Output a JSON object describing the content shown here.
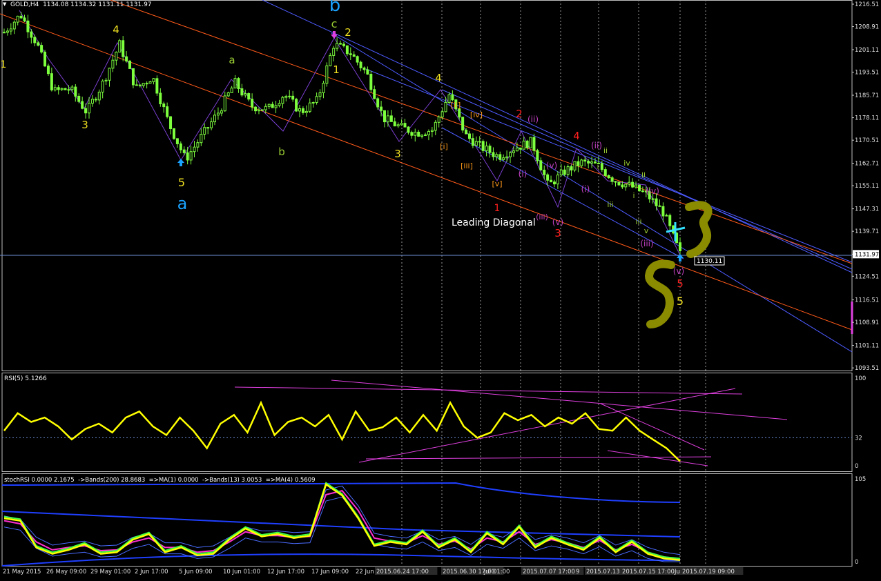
{
  "window": {
    "symbol_header": "GOLD,H4  1134.08 1134.32 1131.11 1131.97",
    "collapse_glyph": "▼",
    "current_price_tag": "1131.97",
    "marker_price_tag": "1130.11",
    "leading_diagonal_text": "Leading Diagonal"
  },
  "colors": {
    "background": "#000000",
    "candles": "#7dff3e",
    "rsi_line": "#ffff00",
    "trend_magenta": "#e040e0",
    "channel_blue": "#4d5bff",
    "channel_orange": "#ff5a1a",
    "wave_yellow": "#f0e020",
    "wave_olive_green": "#9acd32",
    "wave_red": "#ff2020",
    "wave_cyan": "#1aa3ff",
    "wave_orange": "#ff9a1a",
    "wave_violet": "#c040c0",
    "olive_marker": "#8b8b00"
  },
  "chart_data": [
    {
      "type": "candlestick",
      "title": "GOLD,H4",
      "ylim": [
        1093.55,
        1216.51
      ],
      "y_ticks": [
        "1216.51",
        "1208.91",
        "1201.11",
        "1193.51",
        "1185.71",
        "1178.11",
        "1170.51",
        "1162.71",
        "1155.11",
        "1147.31",
        "1139.71",
        "1131.97",
        "1124.51",
        "1116.51",
        "1108.91",
        "1101.11",
        "1093.51"
      ],
      "close_path_approx": [
        {
          "x": "21 May 2015",
          "close": 1207
        },
        {
          "x": "22 May 2015",
          "close": 1213
        },
        {
          "x": "25 May 2015",
          "close": 1203
        },
        {
          "x": "26 May 2015",
          "close": 1187
        },
        {
          "x": "27 May 2015",
          "close": 1188
        },
        {
          "x": "28 May 2015",
          "close": 1180
        },
        {
          "x": "29 May 2015",
          "close": 1190
        },
        {
          "x": "01 Jun 2015",
          "close": 1203
        },
        {
          "x": "02 Jun 2015",
          "close": 1188
        },
        {
          "x": "03 Jun 2015",
          "close": 1192
        },
        {
          "x": "04 Jun 2015",
          "close": 1176
        },
        {
          "x": "05 Jun 2015",
          "close": 1164
        },
        {
          "x": "08 Jun 2015",
          "close": 1172
        },
        {
          "x": "09 Jun 2015",
          "close": 1180
        },
        {
          "x": "10 Jun 2015",
          "close": 1190
        },
        {
          "x": "11 Jun 2015",
          "close": 1182
        },
        {
          "x": "12 Jun 2015",
          "close": 1181
        },
        {
          "x": "15 Jun 2015",
          "close": 1186
        },
        {
          "x": "16 Jun 2015",
          "close": 1180
        },
        {
          "x": "17 Jun 2015",
          "close": 1184
        },
        {
          "x": "18 Jun 2015",
          "close": 1203
        },
        {
          "x": "19 Jun 2015",
          "close": 1200
        },
        {
          "x": "22 Jun 2015",
          "close": 1193
        },
        {
          "x": "23 Jun 2015",
          "close": 1178
        },
        {
          "x": "24 Jun 2015",
          "close": 1175
        },
        {
          "x": "25 Jun 2015",
          "close": 1173
        },
        {
          "x": "26 Jun 2015",
          "close": 1174
        },
        {
          "x": "29 Jun 2015",
          "close": 1186
        },
        {
          "x": "30 Jun 2015",
          "close": 1172
        },
        {
          "x": "01 Jul 2015",
          "close": 1168
        },
        {
          "x": "02 Jul 2015",
          "close": 1165
        },
        {
          "x": "03 Jul 2015",
          "close": 1168
        },
        {
          "x": "06 Jul 2015",
          "close": 1170
        },
        {
          "x": "07 Jul 2015",
          "close": 1155
        },
        {
          "x": "08 Jul 2015",
          "close": 1160
        },
        {
          "x": "09 Jul 2015",
          "close": 1163
        },
        {
          "x": "10 Jul 2015",
          "close": 1162
        },
        {
          "x": "13 Jul 2015",
          "close": 1157
        },
        {
          "x": "14 Jul 2015",
          "close": 1155
        },
        {
          "x": "15 Jul 2015",
          "close": 1152
        },
        {
          "x": "16 Jul 2015",
          "close": 1146
        },
        {
          "x": "17 Jul 2015",
          "close": 1132
        }
      ]
    },
    {
      "type": "line",
      "title": "RSI(5) 5.1266",
      "ylim": [
        0,
        100
      ],
      "y_ticks": [
        "100",
        "32",
        "0"
      ],
      "series": [
        {
          "name": "RSI(5)",
          "values": [
            40,
            60,
            50,
            55,
            45,
            30,
            42,
            48,
            38,
            55,
            62,
            45,
            35,
            55,
            40,
            20,
            48,
            58,
            38,
            72,
            35,
            50,
            55,
            45,
            58,
            30,
            62,
            40,
            44,
            55,
            38,
            58,
            40,
            72,
            45,
            32,
            38,
            60,
            52,
            58,
            45,
            55,
            48,
            60,
            42,
            40,
            55,
            40,
            30,
            20,
            5
          ]
        }
      ]
    },
    {
      "type": "line",
      "title": "stochRSI 0.0000 2.1675  ->Bands(200) 28.8683  =>MA(1) 0.0000  ->Bands(13) 3.0053  =>MA(4) 0.5609",
      "ylim": [
        0,
        105
      ],
      "y_ticks": [
        "105",
        "0"
      ],
      "series": [
        {
          "name": "stochRSI",
          "values": [
            55,
            52,
            18,
            10,
            15,
            22,
            10,
            12,
            28,
            35,
            12,
            18,
            8,
            10,
            28,
            42,
            32,
            35,
            30,
            33,
            98,
            84,
            55,
            20,
            25,
            22,
            38,
            18,
            28,
            12,
            36,
            22,
            44,
            18,
            30,
            22,
            15,
            30,
            12,
            25,
            10,
            4,
            2
          ]
        },
        {
          "name": "MA(4)",
          "values": [
            52,
            48,
            25,
            15,
            18,
            20,
            14,
            15,
            25,
            30,
            18,
            18,
            12,
            14,
            25,
            38,
            33,
            33,
            31,
            32,
            85,
            90,
            65,
            30,
            26,
            24,
            33,
            22,
            26,
            16,
            30,
            25,
            38,
            22,
            28,
            24,
            18,
            27,
            15,
            22,
            12,
            6,
            3
          ]
        }
      ]
    }
  ],
  "time_axis": {
    "labels": [
      "21 May 2015",
      "26 May 09:00",
      "29 May 01:00",
      "2 Jun 17:00",
      "5 Jun 09:00",
      "10 Jun 01:00",
      "12 Jun 17:00",
      "17 Jun 09:00",
      "22 Jun",
      "2015.06.24 17:00",
      "2015.06.30 17:00",
      "Jul 01:00",
      "2015.07.07 17:00",
      "9",
      "2015.07.13",
      "2015.07.15 17:00",
      "Ju",
      "2015.07.19 09:00"
    ]
  },
  "wave_labels": [
    {
      "text": "1",
      "color_key": "wave_yellow"
    },
    {
      "text": "4",
      "color_key": "wave_yellow"
    },
    {
      "text": "3",
      "color_key": "wave_yellow"
    },
    {
      "text": "5",
      "color_key": "wave_yellow"
    },
    {
      "text": "a",
      "color_key": "wave_cyan"
    },
    {
      "text": "a",
      "color_key": "wave_olive_green"
    },
    {
      "text": "b",
      "color_key": "wave_olive_green"
    },
    {
      "text": "b",
      "color_key": "wave_cyan"
    },
    {
      "text": "c",
      "color_key": "wave_olive_green"
    },
    {
      "text": "2",
      "color_key": "wave_yellow"
    },
    {
      "text": "1",
      "color_key": "wave_yellow"
    },
    {
      "text": "3",
      "color_key": "wave_yellow"
    },
    {
      "text": "4",
      "color_key": "wave_yellow"
    },
    {
      "text": "[ii]",
      "color_key": "wave_orange"
    },
    {
      "text": "[iv]",
      "color_key": "wave_orange"
    },
    {
      "text": "[i]",
      "color_key": "wave_orange"
    },
    {
      "text": "[iii]",
      "color_key": "wave_orange"
    },
    {
      "text": "[v]",
      "color_key": "wave_orange"
    },
    {
      "text": "1",
      "color_key": "wave_red"
    },
    {
      "text": "2",
      "color_key": "wave_red"
    },
    {
      "text": "(ii)",
      "color_key": "wave_violet"
    },
    {
      "text": "(i)",
      "color_key": "wave_violet"
    },
    {
      "text": "(iii)",
      "color_key": "wave_violet"
    },
    {
      "text": "(v)",
      "color_key": "wave_violet"
    },
    {
      "text": "(v)",
      "color_key": "wave_violet"
    },
    {
      "text": "3",
      "color_key": "wave_red"
    },
    {
      "text": "4",
      "color_key": "wave_red"
    },
    {
      "text": "(ii)",
      "color_key": "wave_violet"
    },
    {
      "text": "ii",
      "color_key": "wave_olive_green"
    },
    {
      "text": "i",
      "color_key": "wave_olive_green"
    },
    {
      "text": "(i)",
      "color_key": "wave_violet"
    },
    {
      "text": "iii",
      "color_key": "wave_olive_green"
    },
    {
      "text": "iv",
      "color_key": "wave_olive_green"
    },
    {
      "text": "ii",
      "color_key": "wave_olive_green"
    },
    {
      "text": "i",
      "color_key": "wave_olive_green"
    },
    {
      "text": "(iv)",
      "color_key": "wave_violet"
    },
    {
      "text": "iii",
      "color_key": "wave_olive_green"
    },
    {
      "text": "v",
      "color_key": "wave_olive_green"
    },
    {
      "text": "(iii)",
      "color_key": "wave_violet"
    },
    {
      "text": "(v)",
      "color_key": "wave_violet"
    },
    {
      "text": "5",
      "color_key": "wave_red"
    },
    {
      "text": "5",
      "color_key": "wave_yellow"
    }
  ]
}
